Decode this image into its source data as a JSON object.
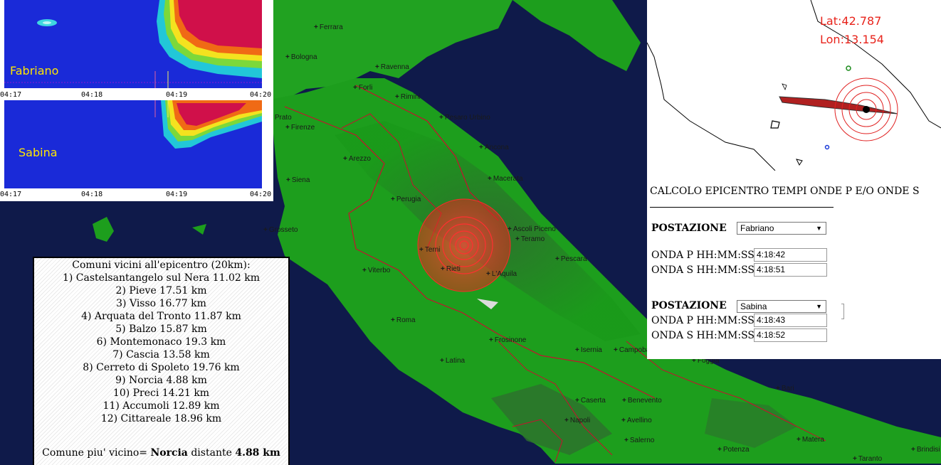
{
  "spectrogram": {
    "stations": [
      {
        "name": "Fabriano",
        "ticks": [
          "04:17",
          "04:18",
          "04:19",
          "04:20"
        ]
      },
      {
        "name": "Sabina",
        "ticks": [
          "04:17",
          "04:18",
          "04:19",
          "04:20"
        ]
      }
    ]
  },
  "minimap": {
    "lat": "Lat:42.787",
    "lon": "Lon:13.154"
  },
  "cities": [
    {
      "name": "Ferrara"
    },
    {
      "name": "Bologna"
    },
    {
      "name": "Ravenna"
    },
    {
      "name": "Forli"
    },
    {
      "name": "Rimini"
    },
    {
      "name": "Pesaro Urbino"
    },
    {
      "name": "Prato"
    },
    {
      "name": "Firenze"
    },
    {
      "name": "Ancona"
    },
    {
      "name": "Arezzo"
    },
    {
      "name": "Macerata"
    },
    {
      "name": "Siena"
    },
    {
      "name": "Perugia"
    },
    {
      "name": "Ascoli Piceno"
    },
    {
      "name": "Teramo"
    },
    {
      "name": "Grosseto"
    },
    {
      "name": "Pescara"
    },
    {
      "name": "Terni"
    },
    {
      "name": "Rieti"
    },
    {
      "name": "L'Aquila"
    },
    {
      "name": "Viterbo"
    },
    {
      "name": "Roma"
    },
    {
      "name": "Frosinone"
    },
    {
      "name": "Isernia"
    },
    {
      "name": "Campobasso"
    },
    {
      "name": "Foggia"
    },
    {
      "name": "Latina"
    },
    {
      "name": "Caserta"
    },
    {
      "name": "Benevento"
    },
    {
      "name": "Napoli"
    },
    {
      "name": "Avellino"
    },
    {
      "name": "Salerno"
    },
    {
      "name": "Matera"
    },
    {
      "name": "Potenza"
    },
    {
      "name": "Taranto"
    },
    {
      "name": "Bari"
    },
    {
      "name": "Brindisi"
    }
  ],
  "form": {
    "title": "CALCOLO EPICENTRO TEMPI ONDE P E/O ONDE S",
    "stations": [
      {
        "label": "POSTAZIONE",
        "selected": "Fabriano",
        "p_label": "ONDA P HH:MM:SS",
        "p_value": "4:18:42",
        "s_label": "ONDA S HH:MM:SS",
        "s_value": "4:18:51"
      },
      {
        "label": "POSTAZIONE",
        "selected": "Sabina",
        "p_label": "ONDA P HH:MM:SS",
        "p_value": "4:18:43",
        "s_label": "ONDA S HH:MM:SS",
        "s_value": "4:18:52"
      }
    ]
  },
  "comuni": {
    "title": "Comuni vicini all'epicentro (20km):",
    "items": [
      "1) Castelsantangelo sul Nera 11.02 km",
      "2) Pieve 17.51 km",
      "3) Visso 16.77 km",
      "4) Arquata del Tronto 11.87 km",
      "5) Balzo 15.87 km",
      "6) Montemonaco 19.3 km",
      "7) Cascia 13.58 km",
      "8) Cerreto di Spoleto 19.76 km",
      "9) Norcia 4.88 km",
      "10) Preci 14.21 km",
      "11) Accumoli 12.89 km",
      "12) Cittareale 18.96 km"
    ],
    "closest_prefix": "Comune piu' vicino=",
    "closest_name": "Norcia",
    "closest_mid": "distante",
    "closest_dist": "4.88 km"
  },
  "colors": {
    "accent_red": "#e8231b",
    "spectro_blue": "#1a2ad8",
    "spectro_hot": "#d0104a",
    "land": "#1c9a1c",
    "sea": "#0f1a4a"
  }
}
